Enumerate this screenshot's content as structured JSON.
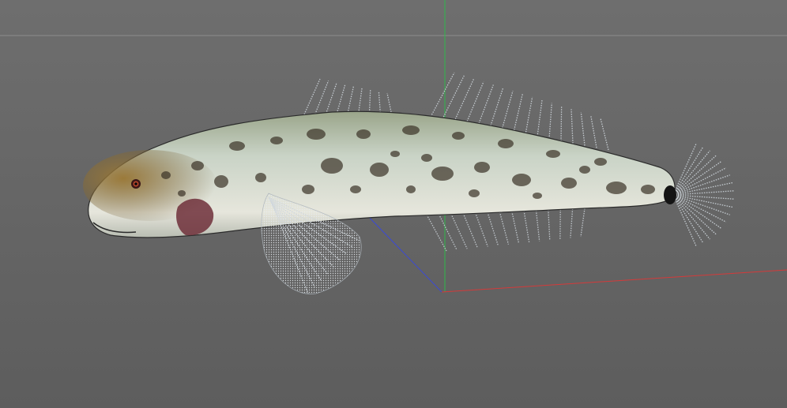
{
  "viewport": {
    "background_top": "#6e6e6e",
    "background_bottom": "#5d5d5d"
  },
  "axes": {
    "x_color": "#d43a3a",
    "y_color": "#2fb84a",
    "z_color": "#3b4ad6",
    "horizon_color": "#8c8c8c"
  },
  "model": {
    "type": "fish",
    "body_color": "#c9d3c6",
    "belly_color": "#e6e6dc",
    "spot_color": "#3a3226",
    "fin_color": "#cfd6dc"
  }
}
